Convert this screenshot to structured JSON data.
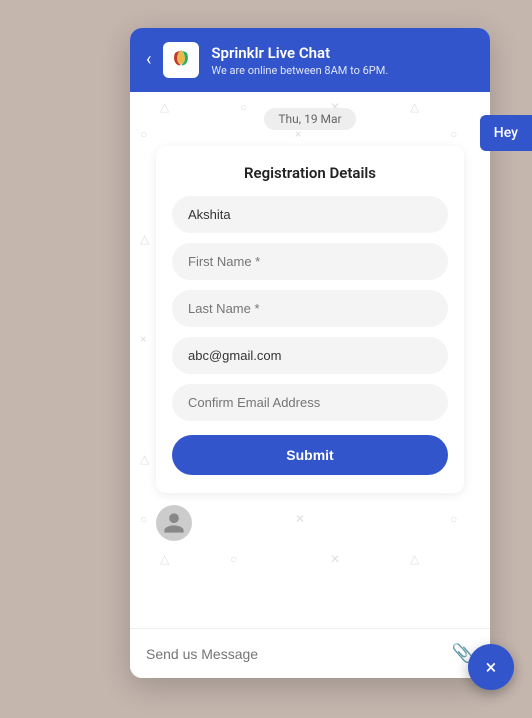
{
  "header": {
    "back_label": "‹",
    "logo_alt": "Sprinklr logo",
    "title": "Sprinklr Live Chat",
    "subtitle": "We are online between 8AM to 6PM.",
    "hey_button": "Hey"
  },
  "chat": {
    "date_pill": "Thu, 19 Mar",
    "registration": {
      "title": "Registration Details",
      "fields": [
        {
          "value": "Akshita",
          "placeholder": "Akshita",
          "type": "filled"
        },
        {
          "value": "",
          "placeholder": "First Name *",
          "type": "placeholder"
        },
        {
          "value": "",
          "placeholder": "Last Name *",
          "type": "placeholder"
        },
        {
          "value": "abc@gmail.com",
          "placeholder": "abc@gmail.com",
          "type": "filled"
        },
        {
          "value": "",
          "placeholder": "Confirm Email Address",
          "type": "placeholder"
        }
      ],
      "submit_label": "Submit"
    }
  },
  "footer": {
    "placeholder": "Send us Message"
  },
  "fab": {
    "icon": "×"
  }
}
